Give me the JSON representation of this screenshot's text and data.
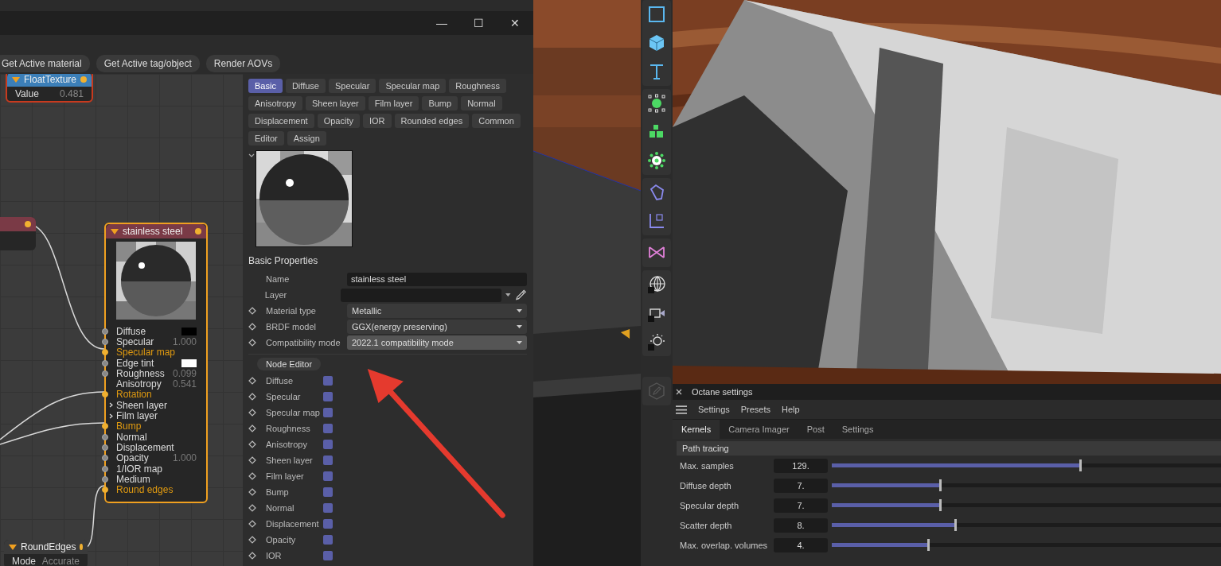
{
  "node_window": {
    "window_buttons": [
      "—",
      "☐",
      "✕"
    ],
    "toolbar": [
      "Get Active material",
      "Get Active tag/object",
      "Render AOVs"
    ],
    "nodes": [
      {
        "kind": "texture",
        "title": "FloatTexture",
        "rows": [
          {
            "name": "Value",
            "value": "0.481"
          }
        ]
      },
      {
        "kind": "stub"
      },
      {
        "kind": "material",
        "title": "stainless steel",
        "ports": [
          {
            "name": "Diffuse",
            "kind": "port",
            "linked": false,
            "color": "#000000"
          },
          {
            "name": "Specular",
            "kind": "port",
            "linked": false,
            "value": "1.000"
          },
          {
            "name": "Specular map",
            "kind": "port",
            "linked": true
          },
          {
            "name": "Edge tint",
            "kind": "port",
            "linked": false,
            "color": "#ffffff"
          },
          {
            "name": "Roughness",
            "kind": "port",
            "linked": false,
            "value": "0.099"
          },
          {
            "name": "Anisotropy",
            "kind": "plain",
            "linked": false,
            "value": "0.541"
          },
          {
            "name": "Rotation",
            "kind": "port",
            "linked": true
          },
          {
            "name": "Sheen layer",
            "kind": "group",
            "linked": false
          },
          {
            "name": "Film layer",
            "kind": "group",
            "linked": false
          },
          {
            "name": "Bump",
            "kind": "port",
            "linked": true
          },
          {
            "name": "Normal",
            "kind": "port",
            "linked": false
          },
          {
            "name": "Displacement",
            "kind": "port",
            "linked": false
          },
          {
            "name": "Opacity",
            "kind": "port",
            "linked": false,
            "value": "1.000"
          },
          {
            "name": "1/IOR map",
            "kind": "port",
            "linked": false
          },
          {
            "name": "Medium",
            "kind": "port",
            "linked": false
          },
          {
            "name": "Round edges",
            "kind": "port",
            "linked": true
          }
        ]
      },
      {
        "kind": "texture",
        "title": "RoundEdges",
        "rows": [
          {
            "name": "Mode",
            "value": "Accurate"
          }
        ]
      }
    ],
    "tab_rows": [
      [
        {
          "label": "Basic",
          "selected": true
        },
        {
          "label": "Diffuse",
          "selected": false
        },
        {
          "label": "Specular",
          "selected": false
        },
        {
          "label": "Specular map",
          "selected": false
        },
        {
          "label": "Roughness",
          "selected": false
        }
      ],
      [
        {
          "label": "Anisotropy",
          "selected": false
        },
        {
          "label": "Sheen layer",
          "selected": false
        },
        {
          "label": "Film layer",
          "selected": false
        },
        {
          "label": "Bump",
          "selected": false
        },
        {
          "label": "Normal",
          "selected": false
        }
      ],
      [
        {
          "label": "Displacement",
          "selected": false
        },
        {
          "label": "Opacity",
          "selected": false
        },
        {
          "label": "IOR",
          "selected": false
        },
        {
          "label": "Rounded edges",
          "selected": false
        },
        {
          "label": "Common",
          "selected": false
        }
      ],
      [
        {
          "label": "Editor",
          "selected": false
        },
        {
          "label": "Assign",
          "selected": false
        }
      ]
    ],
    "section": "Basic Properties",
    "properties": [
      {
        "label": "Name",
        "kind": "text",
        "value": "stainless steel"
      },
      {
        "label": "Layer",
        "kind": "link"
      },
      {
        "label": "Material type",
        "kind": "dropdown",
        "value": "Metallic",
        "highlighted": false
      },
      {
        "label": "BRDF model",
        "kind": "dropdown",
        "value": "GGX(energy preserving)",
        "highlighted": false
      },
      {
        "label": "Compatibility mode",
        "kind": "dropdown",
        "value": "2022.1 compatibility mode",
        "highlighted": true
      }
    ],
    "node_editor_button": "Node Editor",
    "channels": [
      {
        "label": "Diffuse",
        "checked": true
      },
      {
        "label": "Specular",
        "checked": true
      },
      {
        "label": "Specular map",
        "checked": true
      },
      {
        "label": "Roughness",
        "checked": true
      },
      {
        "label": "Anisotropy",
        "checked": true
      },
      {
        "label": "Sheen layer",
        "checked": true
      },
      {
        "label": "Film layer",
        "checked": true
      },
      {
        "label": "Bump",
        "checked": true
      },
      {
        "label": "Normal",
        "checked": true
      },
      {
        "label": "Displacement",
        "checked": true
      },
      {
        "label": "Opacity",
        "checked": true
      },
      {
        "label": "IOR",
        "checked": true
      }
    ]
  },
  "octane": {
    "title": "Octane settings",
    "menu": [
      "Settings",
      "Presets",
      "Help"
    ],
    "tabs": [
      {
        "label": "Kernels",
        "selected": true
      },
      {
        "label": "Camera Imager",
        "selected": false
      },
      {
        "label": "Post",
        "selected": false
      },
      {
        "label": "Settings",
        "selected": false
      }
    ],
    "section": "Path tracing",
    "sliders": [
      {
        "label": "Max. samples",
        "value": "129.",
        "level": 0.64
      },
      {
        "label": "Diffuse depth",
        "value": "7.",
        "level": 0.28
      },
      {
        "label": "Specular depth",
        "value": "7.",
        "level": 0.28
      },
      {
        "label": "Scatter depth",
        "value": "8.",
        "level": 0.32
      },
      {
        "label": "Max. overlap. volumes",
        "value": "4.",
        "level": 0.25
      }
    ]
  }
}
